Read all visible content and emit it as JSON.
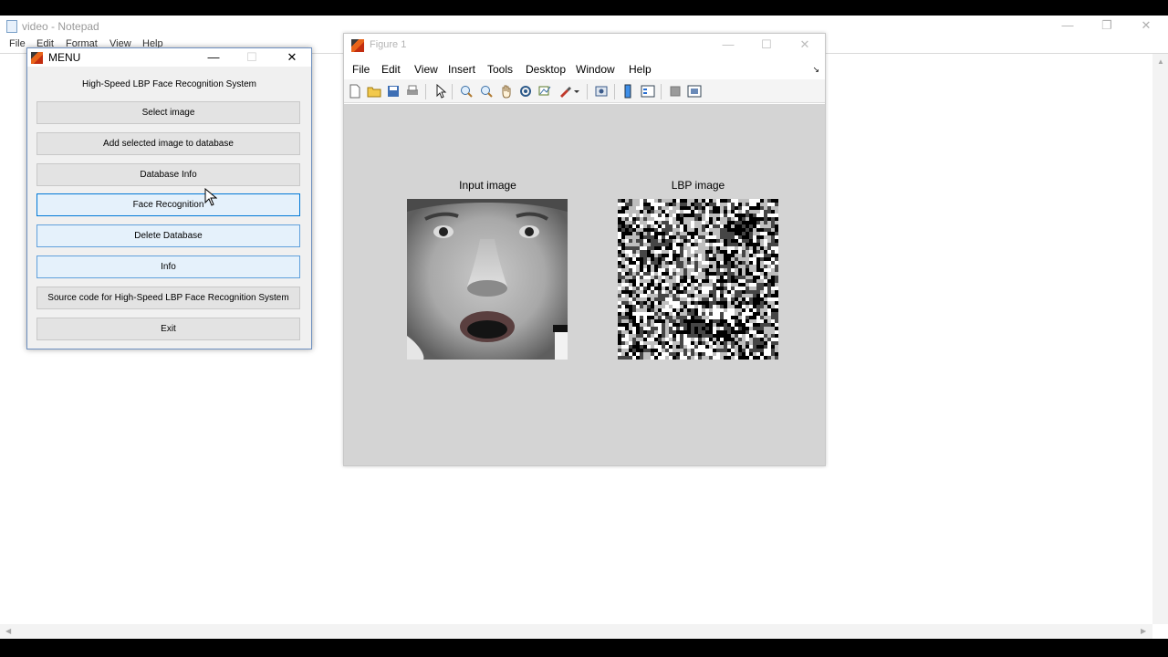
{
  "notepad": {
    "title": "video - Notepad",
    "menu": [
      "File",
      "Edit",
      "Format",
      "View",
      "Help"
    ],
    "controls": {
      "minimize": "—",
      "restore": "❐",
      "close": "✕"
    }
  },
  "menu_window": {
    "title": "MENU",
    "heading": "High-Speed LBP Face Recognition System",
    "controls": {
      "minimize": "—",
      "maximize": "☐",
      "close": "✕"
    },
    "buttons": [
      "Select image",
      "Add selected image to database",
      "Database Info",
      "Face Recognition",
      "Delete Database",
      "Info",
      "Source code for High-Speed LBP Face Recognition System",
      "Exit"
    ]
  },
  "figure_window": {
    "title": "Figure 1",
    "menu": [
      "File",
      "Edit",
      "View",
      "Insert",
      "Tools",
      "Desktop",
      "Window",
      "Help"
    ],
    "dock_glyph": "↘",
    "controls": {
      "minimize": "—",
      "maximize": "☐",
      "close": "✕"
    },
    "toolbar_icons": [
      "new-figure-icon",
      "open-file-icon",
      "save-icon",
      "print-icon",
      "pointer-icon",
      "zoom-in-icon",
      "zoom-out-icon",
      "pan-icon",
      "rotate-icon",
      "data-cursor-icon",
      "brush-icon",
      "link-plot-icon",
      "colorbar-icon",
      "legend-icon",
      "hide-plot-tools-icon",
      "show-plot-tools-icon"
    ],
    "axes": [
      {
        "title": "Input image"
      },
      {
        "title": "LBP image"
      }
    ]
  },
  "colors": {
    "canvas_gray": "#d4d4d4",
    "window_face": "#f0f0f0",
    "button_face": "#e3e3e3",
    "button_highlight_border": "#0078d7",
    "notepad_bg": "#ffffff"
  }
}
